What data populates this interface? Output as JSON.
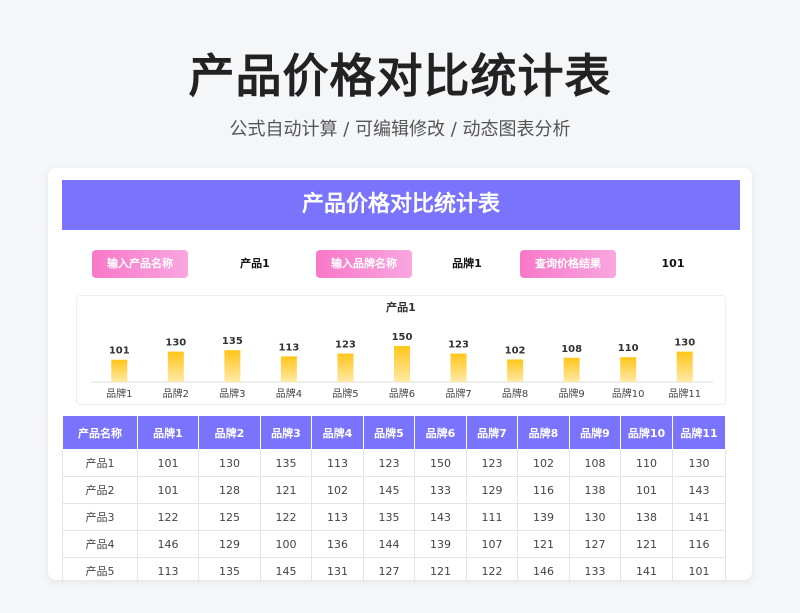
{
  "header": {
    "title": "产品价格对比统计表",
    "subtitle": "公式自动计算 /  可编辑修改  / 动态图表分析"
  },
  "sheet": {
    "banner_title": "产品价格对比统计表"
  },
  "controls": {
    "product_button": "输入产品名称",
    "product_value": "产品1",
    "brand_button": "输入品牌名称",
    "brand_value": "品牌1",
    "query_button": "查询价格结果",
    "query_value": "101"
  },
  "colors": {
    "accent": "#7a73fb",
    "button_pink": "#f778c8",
    "bar_top": "#ffc51a",
    "bar_bottom": "#ffe9a6"
  },
  "chart_data": {
    "type": "bar",
    "title": "产品1",
    "categories": [
      "品牌1",
      "品牌2",
      "品牌3",
      "品牌4",
      "品牌5",
      "品牌6",
      "品牌7",
      "品牌8",
      "品牌9",
      "品牌10",
      "品牌11"
    ],
    "values": [
      101,
      130,
      135,
      113,
      123,
      150,
      123,
      102,
      108,
      110,
      130
    ],
    "ylim": [
      0,
      160
    ],
    "grid": false,
    "legend": "none"
  },
  "table": {
    "headers": [
      "产品名称",
      "品牌1",
      "品牌2",
      "品牌3",
      "品牌4",
      "品牌5",
      "品牌6",
      "品牌7",
      "品牌8",
      "品牌9",
      "品牌10",
      "品牌11"
    ],
    "rows": [
      [
        "产品1",
        "101",
        "130",
        "135",
        "113",
        "123",
        "150",
        "123",
        "102",
        "108",
        "110",
        "130"
      ],
      [
        "产品2",
        "101",
        "128",
        "121",
        "102",
        "145",
        "133",
        "129",
        "116",
        "138",
        "101",
        "143"
      ],
      [
        "产品3",
        "122",
        "125",
        "122",
        "113",
        "135",
        "143",
        "111",
        "139",
        "130",
        "138",
        "141"
      ],
      [
        "产品4",
        "146",
        "129",
        "100",
        "136",
        "144",
        "139",
        "107",
        "121",
        "127",
        "121",
        "116"
      ],
      [
        "产品5",
        "113",
        "135",
        "145",
        "131",
        "127",
        "121",
        "122",
        "146",
        "133",
        "141",
        "101"
      ]
    ]
  }
}
